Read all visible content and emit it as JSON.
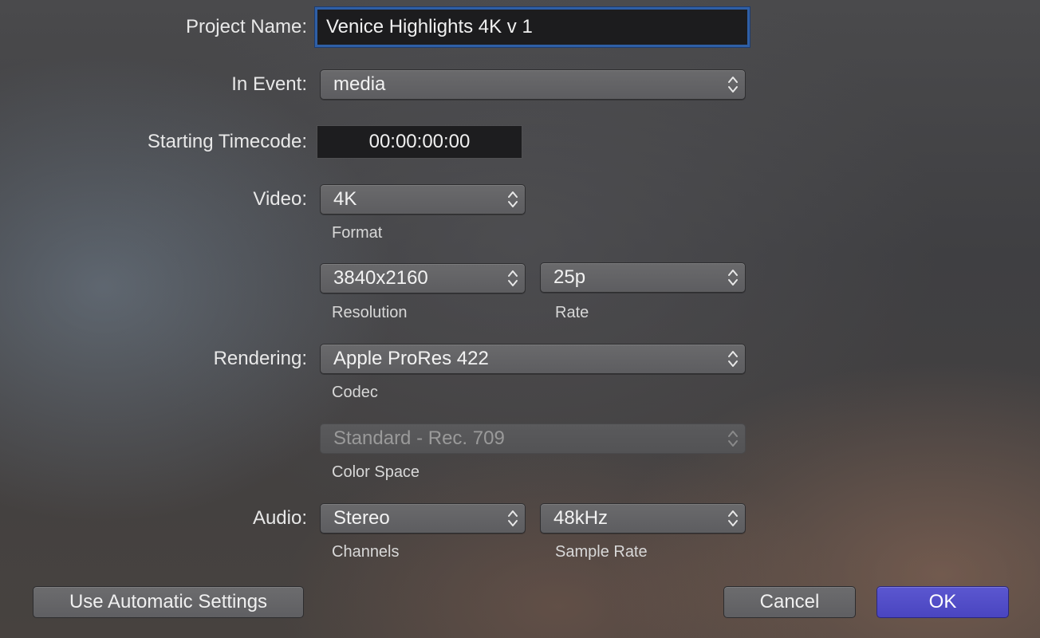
{
  "project_name": {
    "label": "Project Name:",
    "value": "Venice Highlights 4K v 1"
  },
  "in_event": {
    "label": "In Event:",
    "value": "media"
  },
  "starting_timecode": {
    "label": "Starting Timecode:",
    "value": "00:00:00:00"
  },
  "video": {
    "label": "Video:",
    "format": {
      "value": "4K",
      "caption": "Format"
    },
    "resolution": {
      "value": "3840x2160",
      "caption": "Resolution"
    },
    "rate": {
      "value": "25p",
      "caption": "Rate"
    }
  },
  "rendering": {
    "label": "Rendering:",
    "codec": {
      "value": "Apple ProRes 422",
      "caption": "Codec"
    },
    "color_space": {
      "value": "Standard - Rec. 709",
      "caption": "Color Space",
      "enabled": false
    }
  },
  "audio": {
    "label": "Audio:",
    "channels": {
      "value": "Stereo",
      "caption": "Channels"
    },
    "sample_rate": {
      "value": "48kHz",
      "caption": "Sample Rate"
    }
  },
  "buttons": {
    "automatic": "Use Automatic Settings",
    "cancel": "Cancel",
    "ok": "OK"
  },
  "icons": {
    "popup_arrows": "up-down-chevron-icon"
  },
  "colors": {
    "accent": "#4f4bc6",
    "focus_ring": "#2f5fa6"
  }
}
